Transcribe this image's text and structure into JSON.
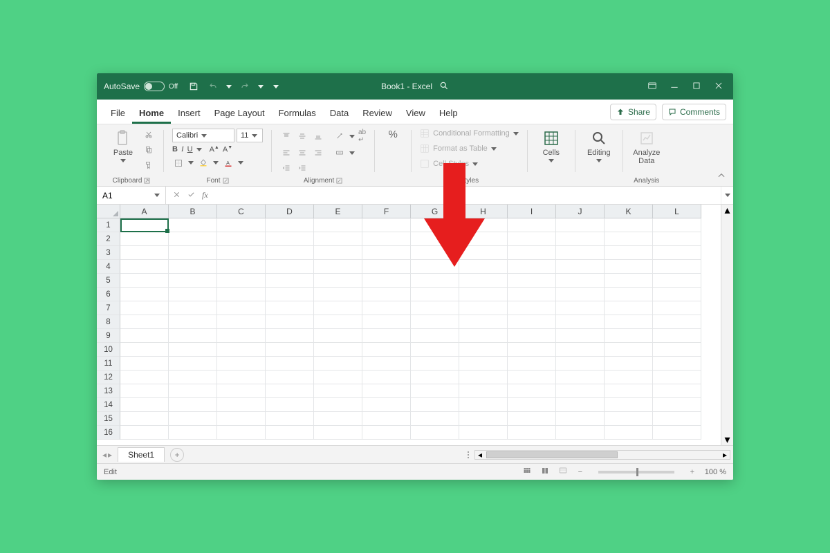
{
  "titlebar": {
    "autosave_label": "AutoSave",
    "autosave_state": "Off",
    "doc_title": "Book1 - Excel"
  },
  "tabs": {
    "items": [
      "File",
      "Home",
      "Insert",
      "Page Layout",
      "Formulas",
      "Data",
      "Review",
      "View",
      "Help"
    ],
    "active_index": 1,
    "share_label": "Share",
    "comments_label": "Comments"
  },
  "ribbon": {
    "clipboard": {
      "paste": "Paste",
      "group_label": "Clipboard"
    },
    "font": {
      "name_value": "Calibri",
      "size_value": "11",
      "bold": "B",
      "italic": "I",
      "underline": "U",
      "group_label": "Font"
    },
    "alignment": {
      "group_label": "Alignment"
    },
    "number": {
      "percent": "%"
    },
    "styles": {
      "conditional": "Conditional Formatting",
      "format_table": "Format as Table",
      "cell_styles": "Cell Styles",
      "group_label": "Styles"
    },
    "cells": {
      "label": "Cells"
    },
    "editing": {
      "label": "Editing"
    },
    "analysis": {
      "analyze_line1": "Analyze",
      "analyze_line2": "Data",
      "group_label": "Analysis"
    }
  },
  "formula": {
    "namebox_value": "A1",
    "fx_label": "fx",
    "input_value": ""
  },
  "grid": {
    "columns": [
      "A",
      "B",
      "C",
      "D",
      "E",
      "F",
      "G",
      "H",
      "I",
      "J",
      "K",
      "L"
    ],
    "row_count": 16
  },
  "sheettabs": {
    "active_sheet": "Sheet1",
    "new_sheet_symbol": "+"
  },
  "statusbar": {
    "mode": "Edit",
    "zoom_text": "100 %"
  }
}
